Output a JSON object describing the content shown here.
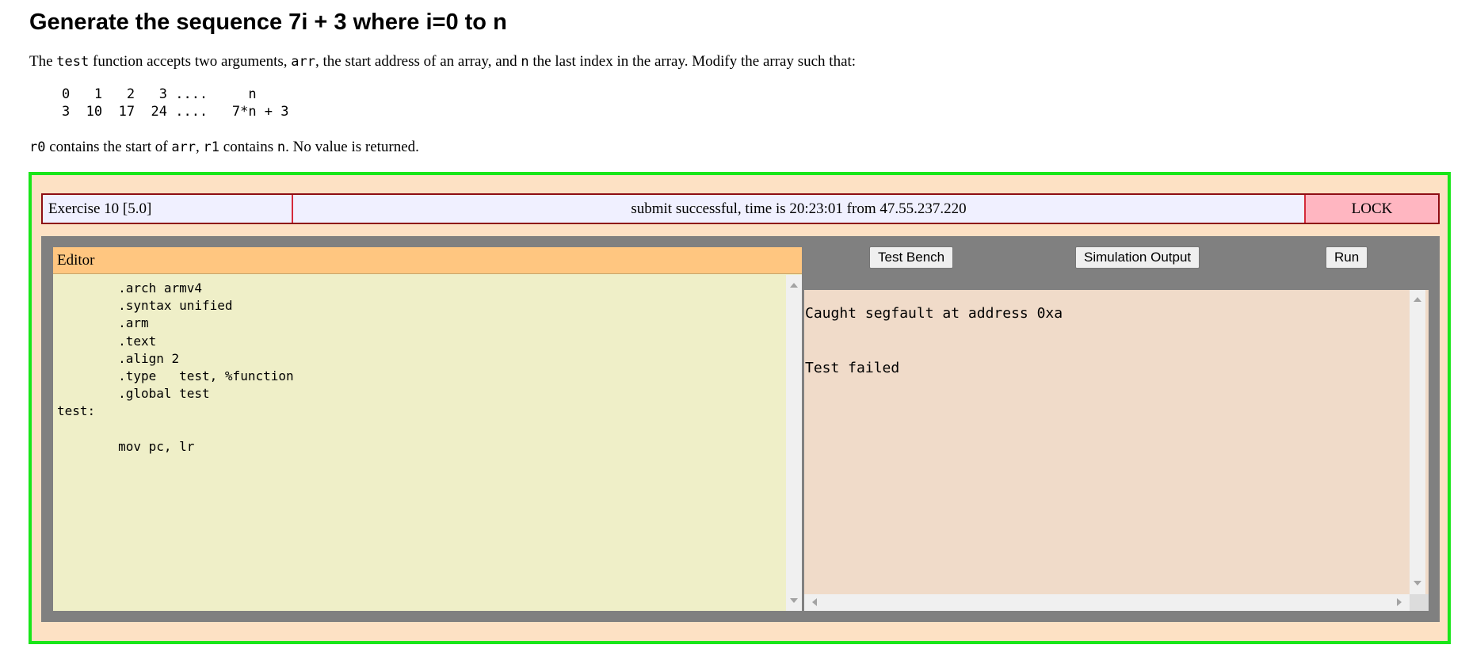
{
  "problem": {
    "title": "Generate the sequence 7i + 3 where i=0 to n",
    "desc_pre": "The ",
    "desc_fn": "test",
    "desc_mid1": " function accepts two arguments, ",
    "desc_arr": "arr",
    "desc_mid2": ", the start address of an array, and ",
    "desc_n": "n",
    "desc_post": " the last index in the array. Modify the array such that:",
    "sequence_text": "    0   1   2   3 ....     n\n    3  10  17  24 ....   7*n + 3",
    "regs_r0": "r0",
    "regs_mid1": " contains the start of ",
    "regs_arr": "arr",
    "regs_mid2": ", ",
    "regs_r1": "r1",
    "regs_mid3": " contains ",
    "regs_n": "n",
    "regs_post": ". No value is returned."
  },
  "status_bar": {
    "exercise": "Exercise 10 [5.0]",
    "message": "submit successful, time is 20:23:01 from 47.55.237.220",
    "lock_label": "LOCK"
  },
  "editor": {
    "header": "Editor",
    "code": "        .arch armv4\n        .syntax unified\n        .arm\n        .text\n        .align 2\n        .type   test, %function\n        .global test\ntest:\n\n        mov pc, lr"
  },
  "toolbar": {
    "test_bench_label": "Test Bench",
    "simulation_output_label": "Simulation Output",
    "run_label": "Run"
  },
  "output": {
    "text": "Caught segfault at address 0xa\n\n\nTest failed"
  },
  "colors": {
    "frame_border": "#19e619",
    "frame_bg": "#fde1c4",
    "editor_header_bg": "#ffc680",
    "editor_bg": "#efefc8",
    "output_bg": "#f0dbc9",
    "lock_bg": "#ffb6c1",
    "status_bg": "#f0f0ff",
    "workarea_bg": "#808080"
  }
}
